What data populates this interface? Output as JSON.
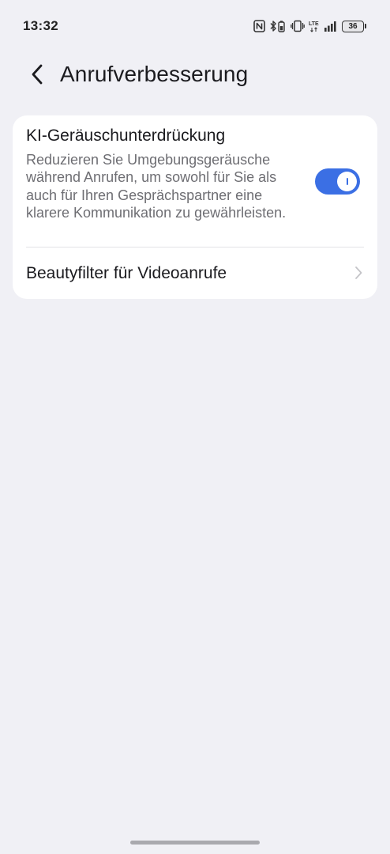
{
  "status_bar": {
    "time": "13:32",
    "battery_level": "36",
    "icons": [
      "nfc-icon",
      "bluetooth-battery-icon",
      "vibrate-icon",
      "lte-icon",
      "signal-icon",
      "battery-icon"
    ]
  },
  "header": {
    "title": "Anrufverbesserung"
  },
  "settings": {
    "noise_reduction": {
      "title": "KI-Geräuschunterdrückung",
      "description": "Reduzieren Sie Umgebungsgeräusche während Anrufen, um sowohl für Sie als auch für Ihren Gesprächspartner eine klarere Kommunikation zu gewährleisten.",
      "enabled": true
    },
    "beauty_filter": {
      "label": "Beautyfilter für Videoanrufe"
    }
  },
  "colors": {
    "accent": "#3b6fe4",
    "background": "#f0f0f5",
    "card": "#ffffff",
    "secondary_text": "#6e6e73"
  }
}
